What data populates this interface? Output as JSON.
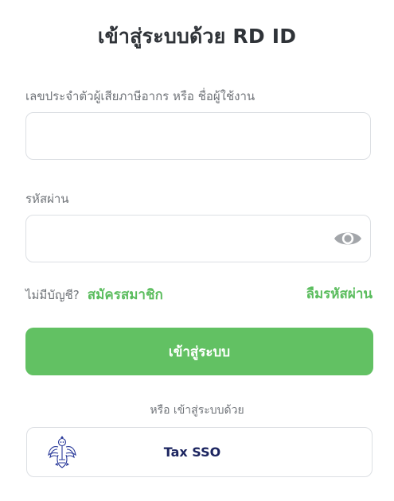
{
  "header": {
    "title": "เข้าสู่ระบบด้วย RD ID"
  },
  "form": {
    "username_label": "เลขประจำตัวผู้เสียภาษีอากร หรือ ชื่อผู้ใช้งาน",
    "username_value": "",
    "password_label": "รหัสผ่าน",
    "password_value": "",
    "show_password_icon": "eye-icon"
  },
  "links": {
    "no_account_text": "ไม่มีบัญชี?",
    "signup_label": "สมัครสมาชิก",
    "forgot_password_label": "ลืมรหัสผ่าน"
  },
  "actions": {
    "login_label": "เข้าสู่ระบบ",
    "or_text": "หรือ เข้าสู่ระบบด้วย",
    "sso_label": "Tax SSO",
    "sso_logo_icon": "garuda-emblem-icon"
  },
  "colors": {
    "accent_green": "#62c163",
    "link_green": "#5bbd5e",
    "sso_text": "#1c2560",
    "emblem_blue": "#2a3a9a"
  }
}
